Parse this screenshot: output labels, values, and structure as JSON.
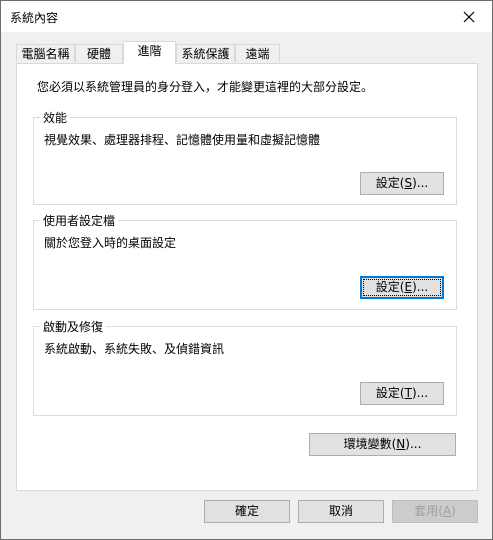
{
  "window": {
    "title": "系統內容"
  },
  "tabs": [
    {
      "label": "電腦名稱"
    },
    {
      "label": "硬體"
    },
    {
      "label": "進階"
    },
    {
      "label": "系統保護"
    },
    {
      "label": "遠端"
    }
  ],
  "active_tab": "進階",
  "intro_text": "您必須以系統管理員的身分登入，才能變更這裡的大部分設定。",
  "groups": {
    "performance": {
      "title": "效能",
      "description": "視覺效果、處理器排程、記憶體使用量和虛擬記憶體",
      "button_label": "設定(",
      "button_key": "S",
      "button_suffix": ")..."
    },
    "user_profiles": {
      "title": "使用者設定檔",
      "description": "關於您登入時的桌面設定",
      "button_label": "設定(",
      "button_key": "E",
      "button_suffix": ")..."
    },
    "startup_recovery": {
      "title": "啟動及修復",
      "description": "系統啟動、系統失敗、及偵錯資訊",
      "button_label": "設定(",
      "button_key": "T",
      "button_suffix": ")..."
    }
  },
  "env_button": {
    "label": "環境變數(",
    "key": "N",
    "suffix": ")..."
  },
  "footer": {
    "ok": "確定",
    "cancel": "取消",
    "apply_label": "套用(",
    "apply_key": "A",
    "apply_suffix": ")"
  },
  "colors": {
    "focus_border": "#0078d7",
    "button_bg": "#e1e1e1",
    "dialog_bg": "#f0f0f0"
  }
}
